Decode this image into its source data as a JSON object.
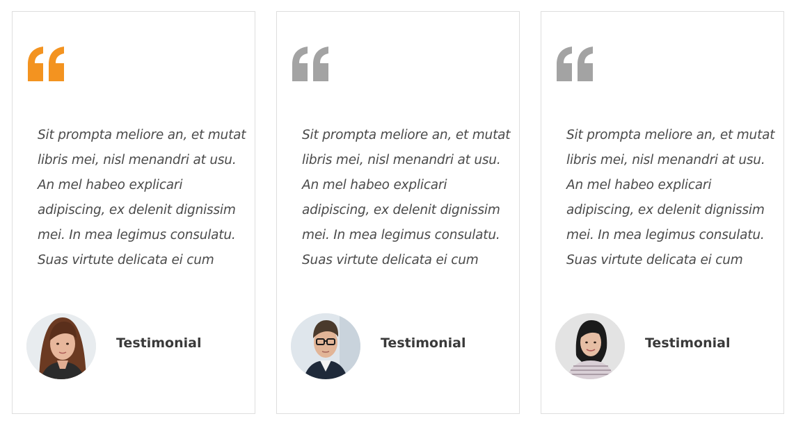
{
  "testimonials": [
    {
      "quote_icon": "quote-icon",
      "quote_color": "#f39320",
      "text": "Sit prompta meliore an, et mutat libris mei, nisl menandri at usu. An mel habeo explicari adipiscing, ex delenit dignissim mei. In mea legimus consulatu. Suas virtute delicata ei cum",
      "avatar": "woman-brown-hair-avatar",
      "name": "Testimonial"
    },
    {
      "quote_icon": "quote-icon",
      "quote_color": "#a3a3a3",
      "text": "Sit prompta meliore an, et mutat libris mei, nisl menandri at usu. An mel habeo explicari adipiscing, ex delenit dignissim mei. In mea legimus consulatu. Suas virtute delicata ei cum",
      "avatar": "man-glasses-avatar",
      "name": "Testimonial"
    },
    {
      "quote_icon": "quote-icon",
      "quote_color": "#a3a3a3",
      "text": "Sit prompta meliore an, et mutat libris mei, nisl menandri at usu. An mel habeo explicari adipiscing, ex delenit dignissim mei. In mea legimus consulatu. Suas virtute delicata ei cum",
      "avatar": "woman-dark-hair-avatar",
      "name": "Testimonial"
    }
  ]
}
